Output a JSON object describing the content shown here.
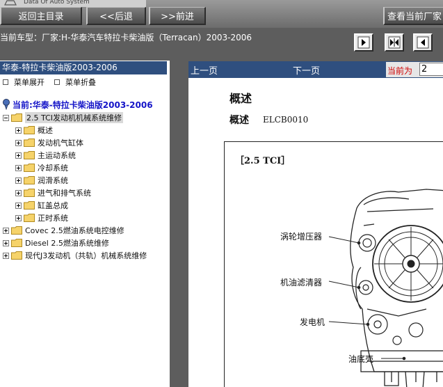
{
  "header": {
    "brand_text": "Data Of Auto System",
    "buttons": {
      "back_home": "返回主目录",
      "prev": "<<后退",
      "next": ">>前进",
      "view_current": "查看当前厂家"
    }
  },
  "vehicle_info": "当前车型：厂家:H-华泰汽车特拉卡柴油版（Terracan）2003-2006",
  "nav_icons": [
    "goto-first-icon",
    "goto-middle-icon",
    "goto-last-icon"
  ],
  "sidebar": {
    "header": "华泰-特拉卡柴油版2003-2006",
    "expand_label": "菜单展开",
    "collapse_label": "菜单折叠",
    "current": "当前:华泰-特拉卡柴油版2003-2006",
    "selected_group": "2.5 TCI发动机机械系统维修",
    "children": [
      "概述",
      "发动机气缸体",
      "主运动系统",
      "冷却系统",
      "润滑系统",
      "进气和排气系统",
      "缸盖总成",
      "正时系统"
    ],
    "top_items": [
      "Covec 2.5燃油系统电控维修",
      "Diesel 2.5燃油系统维修",
      "现代J3发动机（共轨）机械系统维修"
    ]
  },
  "content": {
    "prev_page": "上一页",
    "next_page": "下一页",
    "page_label": "当前为",
    "page_value": "2",
    "title": "概述",
    "subtitle": "概述",
    "doc_code": "ELCB0010",
    "figure": {
      "engine_model": "［2.5 TCI］",
      "callouts": {
        "turbocharger": "涡轮增压器",
        "oil_filter": "机油滤清器",
        "alternator": "发电机",
        "oil_pan": "油底壳"
      }
    }
  },
  "colors": {
    "panel_header_bg": "#2f4f7f",
    "current_item": "#1414c8",
    "page_label": "#d00000",
    "toolbar_bg": "#5d5d5d"
  }
}
